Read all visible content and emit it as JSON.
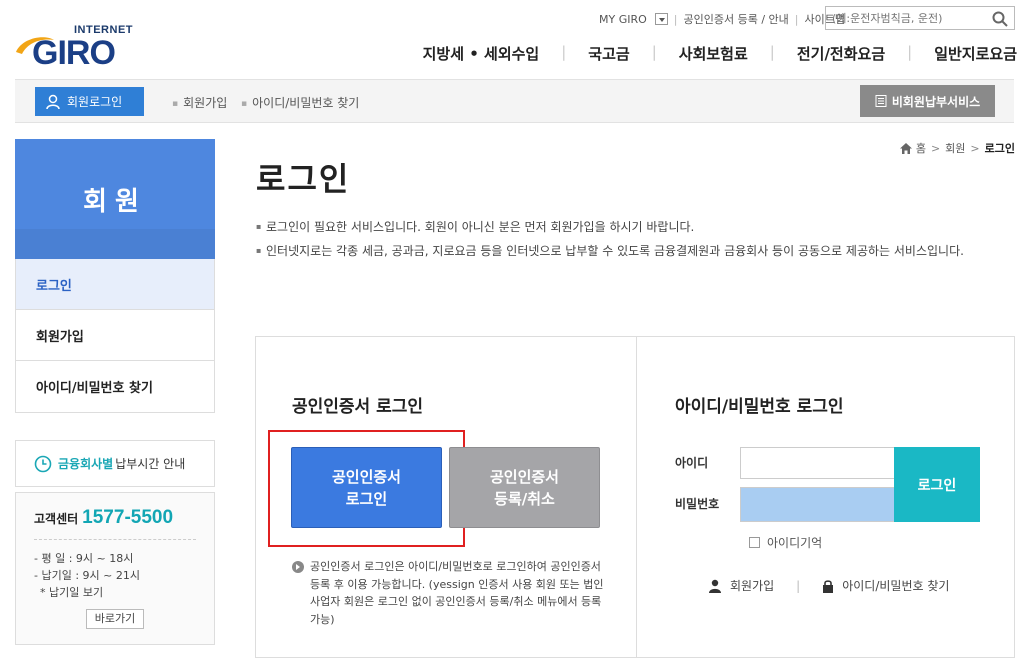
{
  "logo": {
    "small": "INTERNET",
    "big": "GIRO"
  },
  "util": {
    "mygiro": "MY GIRO",
    "cert_link": "공인인증서 등록 / 안내",
    "sitemap": "사이트맵",
    "search_placeholder": "(예:운전자범칙금, 운전)"
  },
  "gnb": [
    "지방세 • 세외수입",
    "국고금",
    "사회보험료",
    "전기/전화요금",
    "일반지로요금"
  ],
  "subbar": {
    "login": "회원로그인",
    "join": "회원가입",
    "find": "아이디/비밀번호 찾기",
    "nonmember": "비회원납부서비스"
  },
  "lnb": {
    "head": "회원",
    "items": [
      "로그인",
      "회원가입",
      "아이디/비밀번호 찾기"
    ]
  },
  "paytime": {
    "highlight": "금융회사별",
    "rest": "납부시간 안내"
  },
  "cs": {
    "label": "고객센터",
    "phone": "1577-5500",
    "lines": [
      "- 평   일 : 9시 ~ 18시",
      "- 납기일 : 9시 ~ 21시",
      "  * 납기일 보기"
    ],
    "button": "바로가기"
  },
  "breadcrumb": {
    "home": "홈",
    "mid": "회원",
    "current": "로그인"
  },
  "title": "로그인",
  "notes": [
    "로그인이 필요한 서비스입니다. 회원이 아니신 분은 먼저 회원가입을 하시기 바랍니다.",
    "인터넷지로는 각종 세금, 공과금, 지로요금 등을 인터넷으로 납부할 수 있도록 금융결제원과 금융회사 등이 공동으로 제공하는 서비스입니다."
  ],
  "cert": {
    "title": "공인인증서 로그인",
    "login_line1": "공인인증서",
    "login_line2": "로그인",
    "reg_line1": "공인인증서",
    "reg_line2": "등록/취소",
    "desc": "공인인증서 로그인은 아이디/비밀번호로 로그인하여 공인인증서 등록 후 이용 가능합니다. (yessign 인증서 사용 회원 또는 법인사업자 회원은 로그인 없이 공인인증서 등록/취소 메뉴에서 등록 가능)"
  },
  "idlogin": {
    "title": "아이디/비밀번호 로그인",
    "id_label": "아이디",
    "pw_label": "비밀번호",
    "button": "로그인",
    "remember": "아이디기억",
    "join": "회원가입",
    "find": "아이디/비밀번호 찾기"
  },
  "colors": {
    "brand_blue": "#3b7ae0",
    "teal": "#1ab8c5",
    "highlight_red": "#e02020",
    "lnb_blue": "#4e87df"
  }
}
